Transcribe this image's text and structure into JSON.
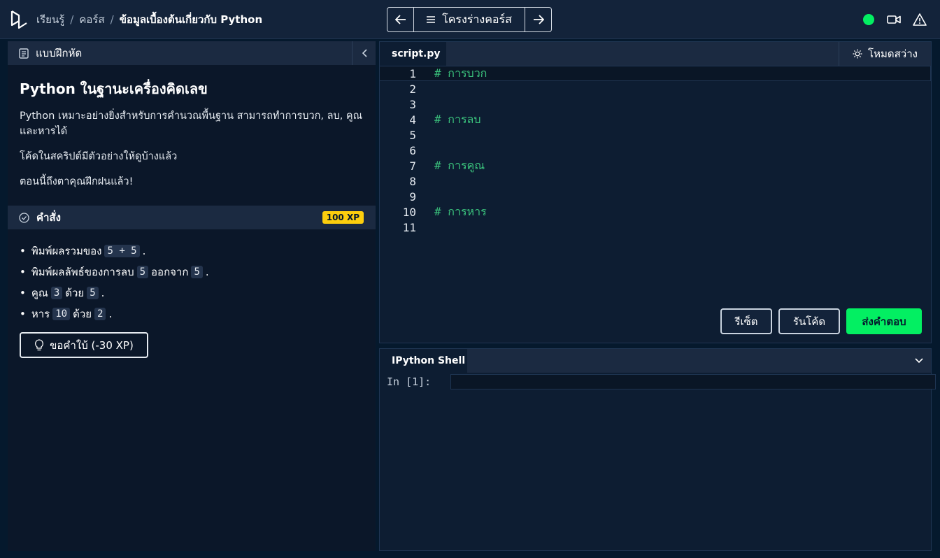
{
  "breadcrumb": {
    "items": [
      "เรียนรู้",
      "คอร์ส"
    ],
    "separator": "/",
    "current": "ข้อมูลเบื้องต้นเกี่ยวกับ Python"
  },
  "nav": {
    "prev_icon": "arrow-left-icon",
    "next_icon": "arrow-right-icon",
    "outline_label": "โครงร่างคอร์ส"
  },
  "status": {
    "color": "#03ef62"
  },
  "exercise": {
    "header": "แบบฝึกหัด",
    "title": "Python ในฐานะเครื่องคิดเลข",
    "paragraphs": [
      "Python เหมาะอย่างยิ่งสำหรับการคำนวณพื้นฐาน สามารถทำการบวก, ลบ, คูณ และหารได้",
      "โค้ดในสคริปต์มีตัวอย่างให้ดูบ้างแล้ว",
      "ตอนนี้ถึงตาคุณฝึกฝนแล้ว!"
    ]
  },
  "instructions": {
    "header": "คำสั่ง",
    "xp": "100 XP",
    "items": [
      {
        "a": "พิมพ์ผลรวมของ",
        "c1": "5 + 5",
        "b": ".",
        "c2": "",
        "d": ""
      },
      {
        "a": "พิมพ์ผลลัพธ์ของการลบ",
        "c1": "5",
        "b": "ออกจาก",
        "c2": "5",
        "d": "."
      },
      {
        "a": "คูณ",
        "c1": "3",
        "b": "ด้วย",
        "c2": "5",
        "d": "."
      },
      {
        "a": "หาร",
        "c1": "10",
        "b": "ด้วย",
        "c2": "2",
        "d": "."
      }
    ],
    "hint_label": "ขอคำใบ้ (-30 XP)"
  },
  "editor": {
    "file_tab": "script.py",
    "light_mode": "โหมดสว่าง",
    "lines": [
      {
        "n": "1",
        "code": "# การบวก"
      },
      {
        "n": "2",
        "code": ""
      },
      {
        "n": "3",
        "code": ""
      },
      {
        "n": "4",
        "code": "# การลบ"
      },
      {
        "n": "5",
        "code": ""
      },
      {
        "n": "6",
        "code": ""
      },
      {
        "n": "7",
        "code": "# การคูณ"
      },
      {
        "n": "8",
        "code": ""
      },
      {
        "n": "9",
        "code": ""
      },
      {
        "n": "10",
        "code": "# การหาร"
      },
      {
        "n": "11",
        "code": ""
      }
    ],
    "reset_label": "รีเซ็ต",
    "run_label": "รันโค้ด",
    "submit_label": "ส่งคำตอบ"
  },
  "shell": {
    "tab": "IPython Shell",
    "prompt": "In [1]:"
  }
}
